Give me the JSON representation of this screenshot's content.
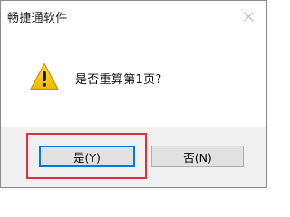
{
  "window": {
    "title": "畅捷通软件",
    "close_icon": "close-icon"
  },
  "dialog": {
    "icon": "warning-icon",
    "message": "是否重算第1页?"
  },
  "buttons": {
    "yes_label": "是(Y)",
    "no_label": "否(N)"
  },
  "colors": {
    "highlight": "#e0313a",
    "focus_border": "#0078d7",
    "warning_fill": "#f5c400"
  }
}
